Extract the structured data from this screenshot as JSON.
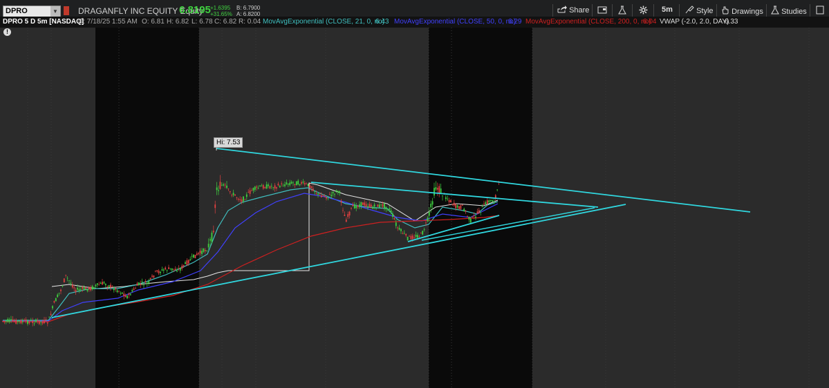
{
  "toolbar": {
    "symbol": "DPRO",
    "company": "DRAGANFLY INC EQUITY Equity",
    "last_price": "6.8195",
    "net_change": "+1.6395",
    "pct_change": "+31.65%",
    "bid": "B: 6.7900",
    "ask": "A: 6.8200",
    "share_label": "Share",
    "timeframe_label": "5m",
    "style_label": "Style",
    "drawings_label": "Drawings",
    "studies_label": "Studies"
  },
  "infobar": {
    "title": "DPRO 5 D 5m [NASDAQ]",
    "date": "D: 7/18/25 1:55 AM",
    "open": "O: 6.81",
    "high": "H: 6.82",
    "low": "L: 6.78",
    "close": "C: 6.82",
    "range": "R: 0.04",
    "ema21_label": "MovAvgExponential (CLOSE, 21, 0, no)",
    "ema21_value": "6.43",
    "ema50_label": "MovAvgExponential (CLOSE, 50, 0, no)",
    "ema50_value": "6.29",
    "ema200_label": "MovAvgExponential (CLOSE, 200, 0, no)",
    "ema200_value": "6.04",
    "vwap_label": "VWAP (-2.0, 2.0, DAY)",
    "vwap_value": "6.33"
  },
  "chart": {
    "hi_label": "Hi: 7.53",
    "alert_glyph": "!"
  },
  "colors": {
    "up_candle": "#3fd03f",
    "down_candle": "#e04040",
    "ema21": "#40c0c0",
    "ema50": "#4040ff",
    "ema200": "#d02020",
    "vwap": "#e8e8e8",
    "trendline": "#30d8e0"
  },
  "chart_data": {
    "type": "candlestick",
    "symbol": "DPRO",
    "interval": "5m",
    "period": "5 D",
    "high_marker": 7.53,
    "last": 6.82,
    "studies": [
      {
        "name": "MovAvgExponential (CLOSE, 21, 0, no)",
        "value": 6.43
      },
      {
        "name": "MovAvgExponential (CLOSE, 50, 0, no)",
        "value": 6.29
      },
      {
        "name": "MovAvgExponential (CLOSE, 200, 0, no)",
        "value": 6.04
      },
      {
        "name": "VWAP (-2.0, 2.0, DAY)",
        "value": 6.33
      }
    ]
  }
}
